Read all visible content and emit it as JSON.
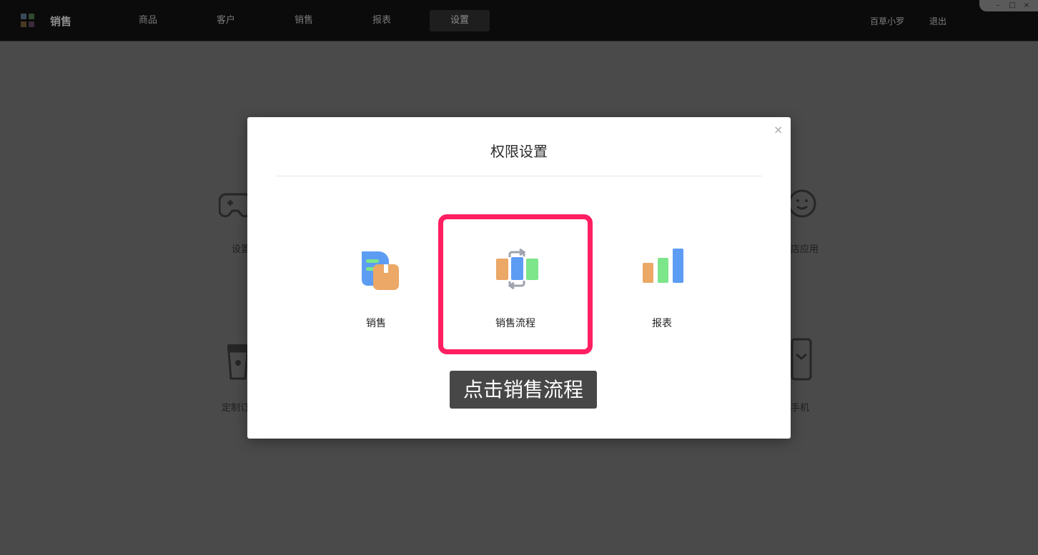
{
  "app": {
    "title": "销售",
    "nav": [
      "商品",
      "客户",
      "销售",
      "报表",
      "设置"
    ],
    "active_nav": "设置",
    "user_name": "百草小罗",
    "logout_label": "退出"
  },
  "window_controls": {
    "minimize": "–",
    "maximize": "□",
    "close": "×"
  },
  "background_cards": {
    "left_top_label": "设置",
    "right_top_label": "店应用",
    "left_bottom_label": "定制订",
    "right_bottom_label": "手机"
  },
  "modal": {
    "title": "权限设置",
    "close_label": "×",
    "options": [
      {
        "label": "销售",
        "icon": "sales-document-icon"
      },
      {
        "label": "销售流程",
        "icon": "sales-flow-icon"
      },
      {
        "label": "报表",
        "icon": "bar-chart-icon"
      }
    ],
    "highlighted_option": "销售流程"
  },
  "hint": "点击销售流程",
  "colors": {
    "highlight": "#ff1f62",
    "orange": "#eba866",
    "blue": "#5d9cf3",
    "green": "#7de58a",
    "gray": "#9ea3ad"
  }
}
